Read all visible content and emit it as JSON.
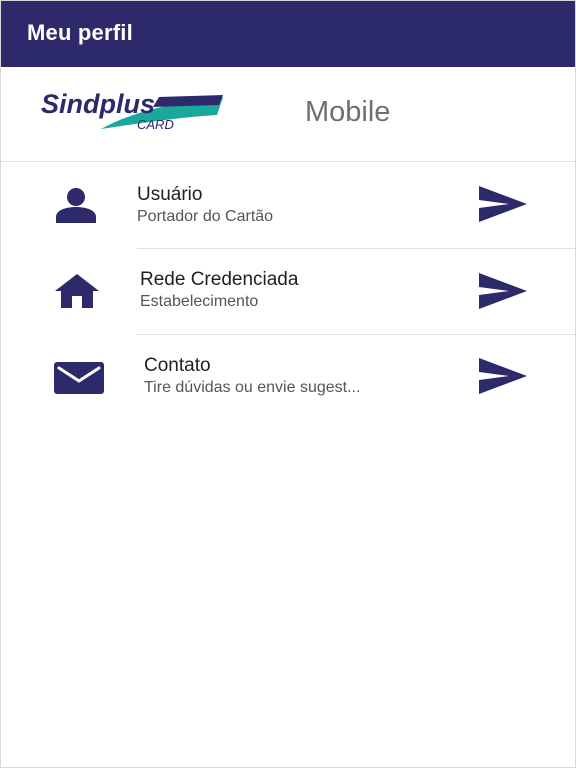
{
  "appbar": {
    "title": "Meu perfil",
    "background": "#2d2a6b"
  },
  "brand": {
    "logo_wordmark": "Sindplus",
    "logo_sub": "CARD",
    "logo_colors": {
      "navy": "#2d2a6b",
      "teal": "#1aa89a"
    },
    "tagline": "Mobile"
  },
  "menu": {
    "items": [
      {
        "title": "Usuário",
        "subtitle": "Portador do Cartão",
        "icon": "person-icon"
      },
      {
        "title": "Rede Credenciada",
        "subtitle": "Estabelecimento",
        "icon": "home-icon"
      },
      {
        "title": "Contato",
        "subtitle": "Tire dúvidas ou envie sugest...",
        "icon": "mail-icon"
      }
    ],
    "action_icon": "send-icon",
    "icon_color": "#2d2a6b"
  }
}
